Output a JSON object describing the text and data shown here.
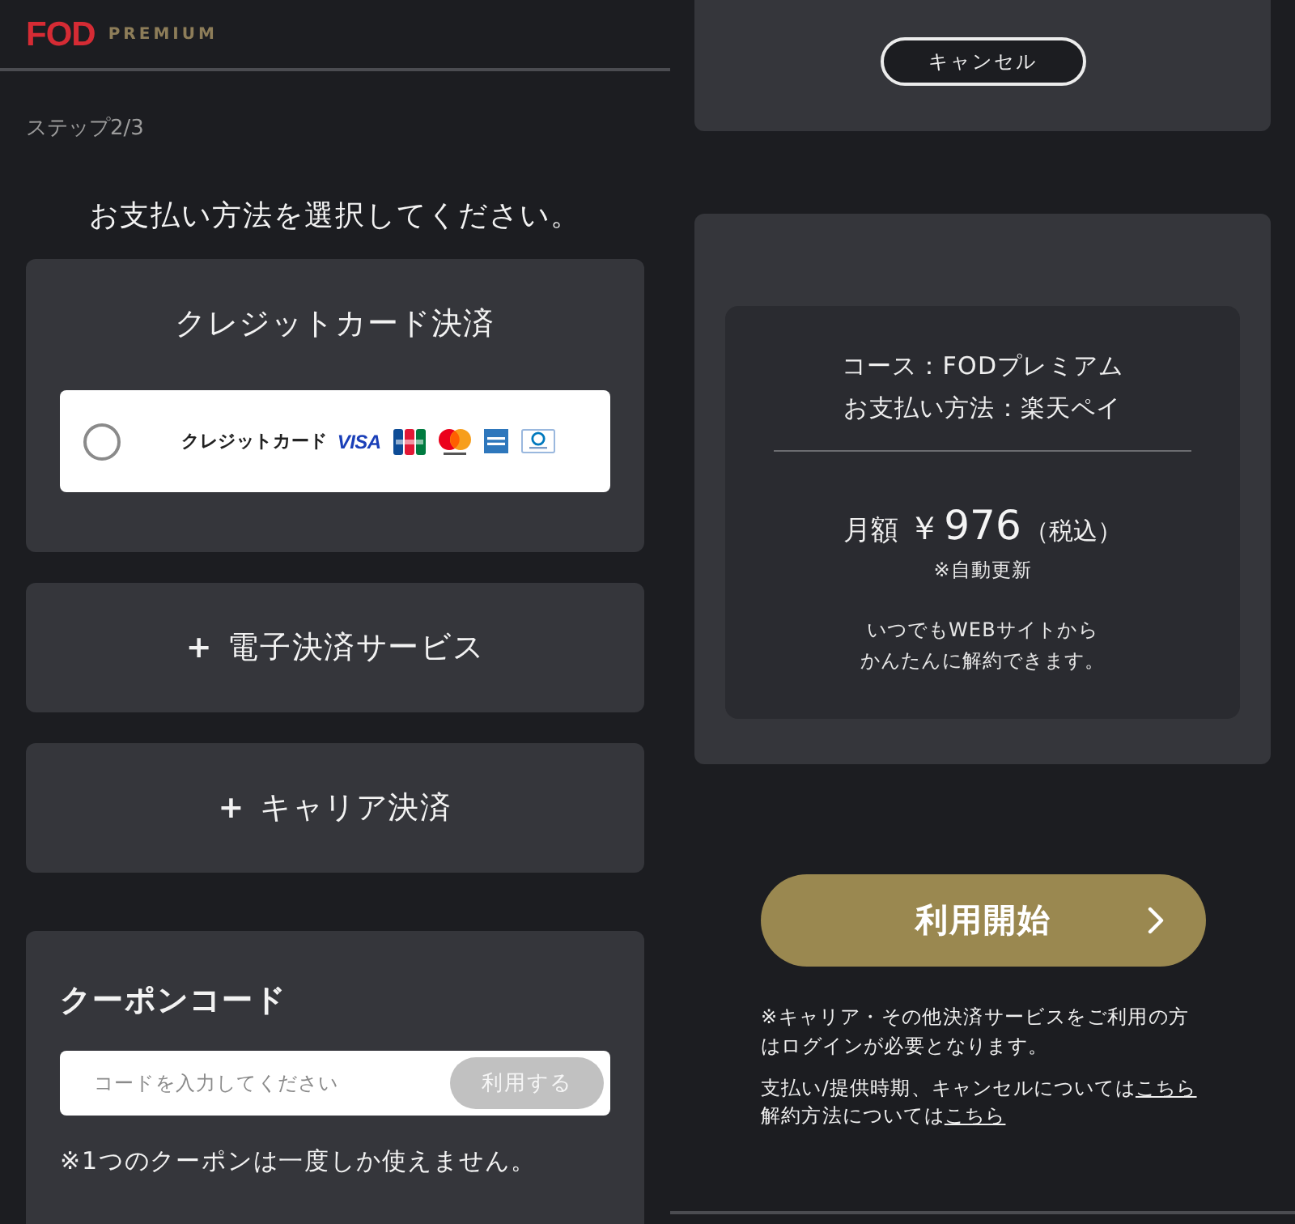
{
  "payment_screen": {
    "logo": {
      "mark": "FOD",
      "label": "PREMIUM"
    },
    "step": "ステップ2/3",
    "heading": "お支払い方法を選択してください。",
    "payment_sections": [
      {
        "title": "クレジットカード決済",
        "expanded": true,
        "options": [
          {
            "label": "クレジットカード",
            "brand_text": "VISA",
            "selected": false
          }
        ]
      },
      {
        "title": "電子決済サービス",
        "toggle": "+",
        "expanded": false
      },
      {
        "title": "キャリア決済",
        "toggle": "+",
        "expanded": false
      }
    ],
    "coupon": {
      "title": "クーポンコード",
      "input": {
        "placeholder": "コードを入力してください"
      },
      "apply_button": {
        "label": "利用する",
        "disabled": true
      },
      "note": "※1つのクーポンは一度しか使えません。"
    }
  },
  "confirm_screen": {
    "cancel_button": "キャンセル",
    "summary": {
      "course": "コース：FODプレミアム",
      "payment_method": "お支払い方法：楽天ペイ",
      "price_label": "月額",
      "currency": "￥",
      "amount": "976",
      "tax_note": "（税込）",
      "renewal_note": "※自動更新",
      "cancel_note_lines": [
        "いつでもWEBサイトから",
        "かんたんに解約できます。"
      ]
    },
    "start_button": "利用開始",
    "login_note": "※キャリア・その他決済サービスをご利用の方はログインが必要となります。",
    "info_lines": [
      {
        "text": "支払い/提供時期、キャンセルについては",
        "link": "こちら"
      },
      {
        "text": "解約方法については",
        "link": "こちら"
      }
    ]
  }
}
